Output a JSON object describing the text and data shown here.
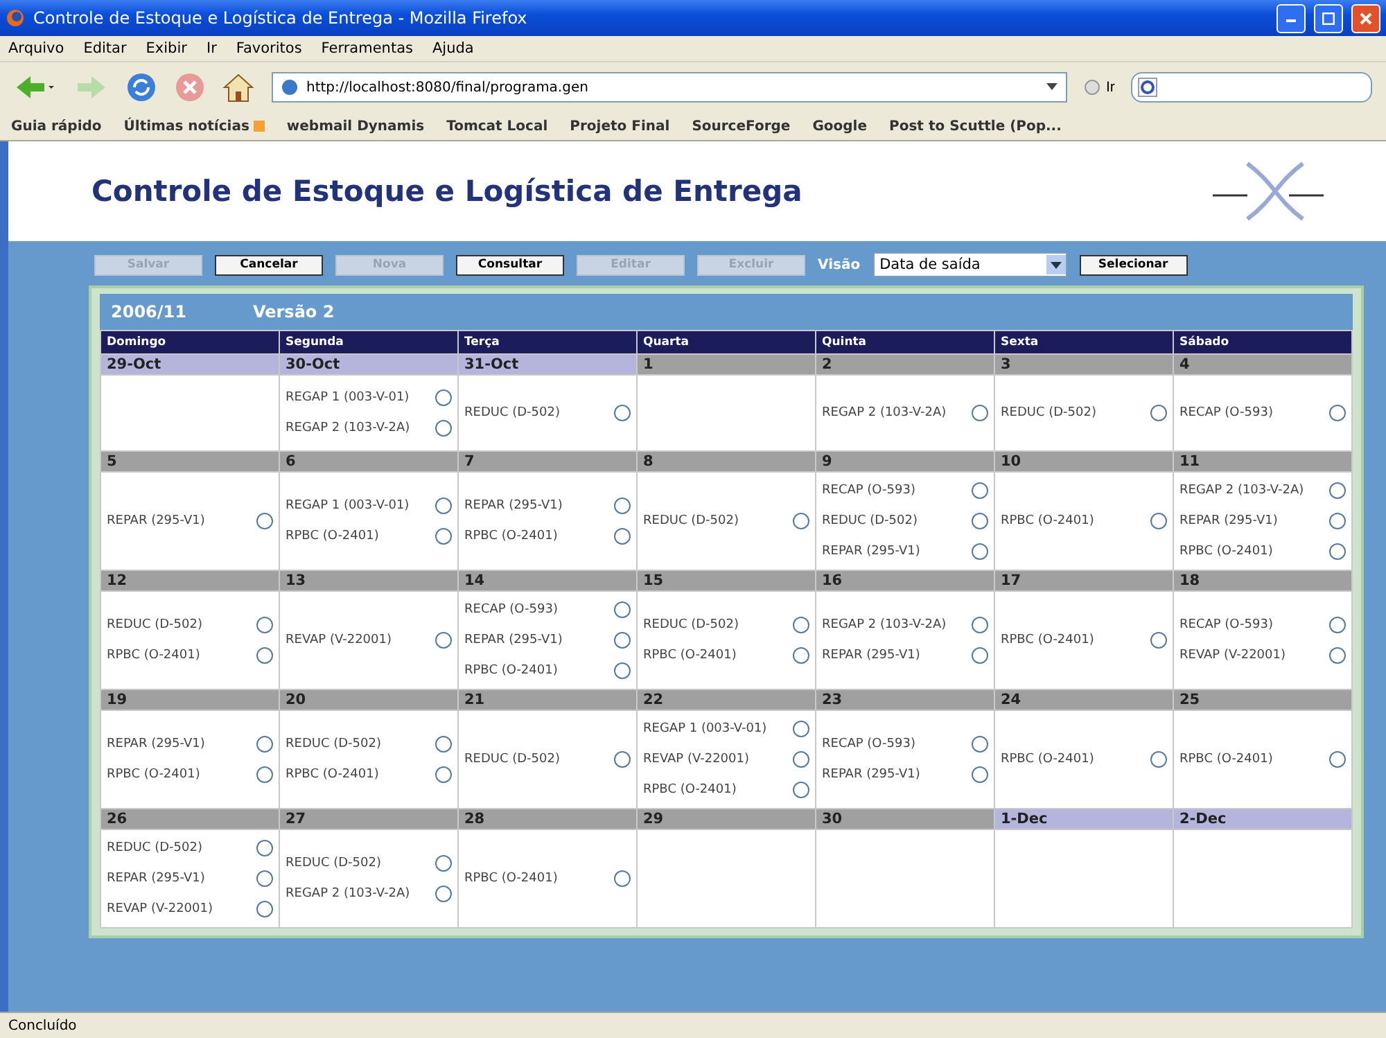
{
  "window": {
    "title": "Controle de Estoque e Logística de Entrega - Mozilla Firefox"
  },
  "menu": [
    "Arquivo",
    "Editar",
    "Exibir",
    "Ir",
    "Favoritos",
    "Ferramentas",
    "Ajuda"
  ],
  "address": {
    "value": "http://localhost:8080/final/programa.gen",
    "go": "Ir"
  },
  "bookmarks": [
    {
      "label": "Guia rápido",
      "kind": "link"
    },
    {
      "label": "Últimas notícias",
      "kind": "feed"
    },
    {
      "label": "webmail Dynamis",
      "kind": "link"
    },
    {
      "label": "Tomcat Local",
      "kind": "link"
    },
    {
      "label": "Projeto Final",
      "kind": "link"
    },
    {
      "label": "SourceForge",
      "kind": "link"
    },
    {
      "label": "Google",
      "kind": "link"
    },
    {
      "label": "Post to Scuttle (Pop...",
      "kind": "link"
    }
  ],
  "page": {
    "title": "Controle de Estoque e Logística de Entrega"
  },
  "toolbar": {
    "buttons": [
      {
        "label": "Salvar",
        "disabled": true
      },
      {
        "label": "Cancelar",
        "disabled": false
      },
      {
        "label": "Nova",
        "disabled": true
      },
      {
        "label": "Consultar",
        "disabled": false
      },
      {
        "label": "Editar",
        "disabled": true
      },
      {
        "label": "Excluir",
        "disabled": true
      }
    ],
    "view_label": "Visão",
    "view_value": "Data de saída",
    "select_button": "Selecionar"
  },
  "calendar": {
    "month": "2006/11",
    "version": "Versão 2",
    "days": [
      "Domingo",
      "Segunda",
      "Terça",
      "Quarta",
      "Quinta",
      "Sexta",
      "Sábado"
    ],
    "weeks": [
      [
        {
          "date": "29-Oct",
          "other_month": true
        },
        {
          "date": "30-Oct",
          "other_month": true,
          "entries": [
            {
              "label": "REGAP 1 (003-V-01)",
              "selected": false
            },
            {
              "label": "REGAP 2 (103-V-2A)",
              "selected": false
            }
          ]
        },
        {
          "date": "31-Oct",
          "other_month": true,
          "entries": [
            {
              "label": "REDUC (D-502)",
              "selected": false
            }
          ]
        },
        {
          "date": "1",
          "other_month": false
        },
        {
          "date": "2",
          "other_month": false,
          "entries": [
            {
              "label": "REGAP 2 (103-V-2A)",
              "selected": false
            }
          ]
        },
        {
          "date": "3",
          "other_month": false,
          "entries": [
            {
              "label": "REDUC (D-502)",
              "selected": false
            }
          ]
        },
        {
          "date": "4",
          "other_month": false,
          "entries": [
            {
              "label": "RECAP (O-593)",
              "selected": false
            }
          ]
        }
      ],
      [
        {
          "date": "5",
          "other_month": false,
          "entries": [
            {
              "label": "REPAR (295-V1)",
              "selected": false
            }
          ]
        },
        {
          "date": "6",
          "other_month": false,
          "entries": [
            {
              "label": "REGAP 1 (003-V-01)",
              "selected": false
            },
            {
              "label": "RPBC (O-2401)",
              "selected": false
            }
          ]
        },
        {
          "date": "7",
          "other_month": false,
          "entries": [
            {
              "label": "REPAR (295-V1)",
              "selected": false
            },
            {
              "label": "RPBC (O-2401)",
              "selected": false
            }
          ]
        },
        {
          "date": "8",
          "other_month": false,
          "entries": [
            {
              "label": "REDUC (D-502)",
              "selected": false
            }
          ]
        },
        {
          "date": "9",
          "other_month": false,
          "entries": [
            {
              "label": "RECAP (O-593)",
              "selected": false
            },
            {
              "label": "REDUC (D-502)",
              "selected": false
            },
            {
              "label": "REPAR (295-V1)",
              "selected": false
            }
          ]
        },
        {
          "date": "10",
          "other_month": false,
          "entries": [
            {
              "label": "RPBC (O-2401)",
              "selected": false
            }
          ]
        },
        {
          "date": "11",
          "other_month": false,
          "entries": [
            {
              "label": "REGAP 2 (103-V-2A)",
              "selected": false
            },
            {
              "label": "REPAR (295-V1)",
              "selected": false
            },
            {
              "label": "RPBC (O-2401)",
              "selected": false
            }
          ]
        }
      ],
      [
        {
          "date": "12",
          "other_month": false,
          "entries": [
            {
              "label": "REDUC (D-502)",
              "selected": false
            },
            {
              "label": "RPBC (O-2401)",
              "selected": false
            }
          ]
        },
        {
          "date": "13",
          "other_month": false,
          "entries": [
            {
              "label": "REVAP (V-22001)",
              "selected": false
            }
          ]
        },
        {
          "date": "14",
          "other_month": false,
          "entries": [
            {
              "label": "RECAP (O-593)",
              "selected": false
            },
            {
              "label": "REPAR (295-V1)",
              "selected": false
            },
            {
              "label": "RPBC (O-2401)",
              "selected": false
            }
          ]
        },
        {
          "date": "15",
          "other_month": false,
          "entries": [
            {
              "label": "REDUC (D-502)",
              "selected": false
            },
            {
              "label": "RPBC (O-2401)",
              "selected": false
            }
          ]
        },
        {
          "date": "16",
          "other_month": false,
          "entries": [
            {
              "label": "REGAP 2 (103-V-2A)",
              "selected": false
            },
            {
              "label": "REPAR (295-V1)",
              "selected": false
            }
          ]
        },
        {
          "date": "17",
          "other_month": false,
          "entries": [
            {
              "label": "RPBC (O-2401)",
              "selected": false
            }
          ]
        },
        {
          "date": "18",
          "other_month": false,
          "entries": [
            {
              "label": "RECAP (O-593)",
              "selected": false
            },
            {
              "label": "REVAP (V-22001)",
              "selected": false
            }
          ]
        }
      ],
      [
        {
          "date": "19",
          "other_month": false,
          "entries": [
            {
              "label": "REPAR (295-V1)",
              "selected": false
            },
            {
              "label": "RPBC (O-2401)",
              "selected": false
            }
          ]
        },
        {
          "date": "20",
          "other_month": false,
          "entries": [
            {
              "label": "REDUC (D-502)",
              "selected": false
            },
            {
              "label": "RPBC (O-2401)",
              "selected": false
            }
          ]
        },
        {
          "date": "21",
          "other_month": false,
          "entries": [
            {
              "label": "REDUC (D-502)",
              "selected": false
            }
          ]
        },
        {
          "date": "22",
          "other_month": false,
          "entries": [
            {
              "label": "REGAP 1 (003-V-01)",
              "selected": false
            },
            {
              "label": "REVAP (V-22001)",
              "selected": false
            },
            {
              "label": "RPBC (O-2401)",
              "selected": false
            }
          ]
        },
        {
          "date": "23",
          "other_month": false,
          "entries": [
            {
              "label": "RECAP (O-593)",
              "selected": false
            },
            {
              "label": "REPAR (295-V1)",
              "selected": false
            }
          ]
        },
        {
          "date": "24",
          "other_month": false,
          "entries": [
            {
              "label": "RPBC (O-2401)",
              "selected": false
            }
          ]
        },
        {
          "date": "25",
          "other_month": false,
          "entries": [
            {
              "label": "RPBC (O-2401)",
              "selected": false
            }
          ]
        }
      ],
      [
        {
          "date": "26",
          "other_month": false,
          "entries": [
            {
              "label": "REDUC (D-502)",
              "selected": false
            },
            {
              "label": "REPAR (295-V1)",
              "selected": false
            },
            {
              "label": "REVAP (V-22001)",
              "selected": false
            }
          ]
        },
        {
          "date": "27",
          "other_month": false,
          "entries": [
            {
              "label": "REDUC (D-502)",
              "selected": false
            },
            {
              "label": "REGAP 2 (103-V-2A)",
              "selected": false
            }
          ]
        },
        {
          "date": "28",
          "other_month": false,
          "entries": [
            {
              "label": "RPBC (O-2401)",
              "selected": false
            }
          ]
        },
        {
          "date": "29",
          "other_month": false
        },
        {
          "date": "30",
          "other_month": false
        },
        {
          "date": "1-Dec",
          "other_month": true
        },
        {
          "date": "2-Dec",
          "other_month": true
        }
      ]
    ]
  },
  "status_bar": "Concluído"
}
